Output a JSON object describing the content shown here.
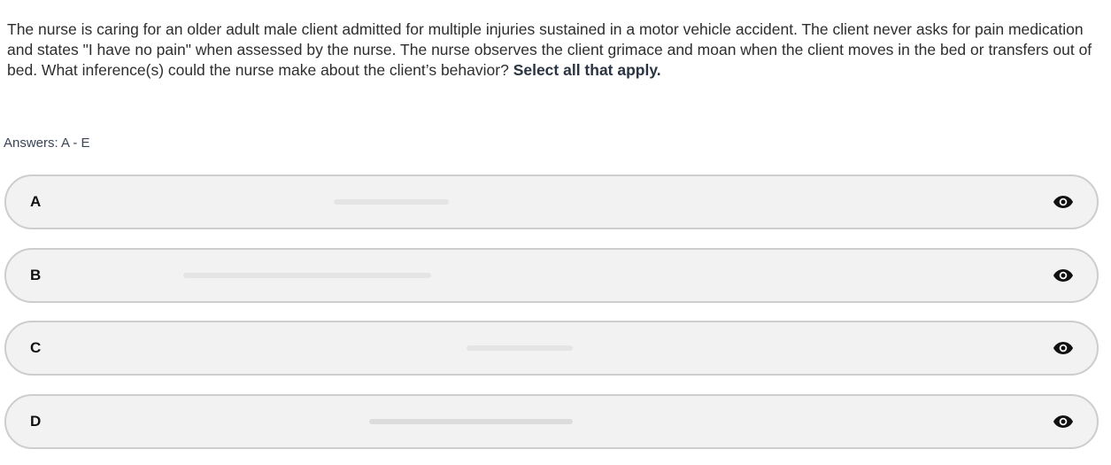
{
  "question": {
    "text": "The nurse is caring for an older adult male client admitted for multiple injuries sustained in a motor vehicle accident. The client never asks for pain medication and states \"I have no pain\" when assessed by the nurse. The nurse observes the client grimace and moan when the client moves in the bed or transfers out of bed. What inference(s) could the nurse make about the client’s behavior?",
    "emphasis": "Select all that apply."
  },
  "answers_label": "Answers: A - E",
  "options": [
    {
      "letter": "A",
      "icon": "eye-icon"
    },
    {
      "letter": "B",
      "icon": "eye-icon"
    },
    {
      "letter": "C",
      "icon": "eye-icon"
    },
    {
      "letter": "D",
      "icon": "eye-icon"
    }
  ],
  "colors": {
    "option_background": "#f2f2f2",
    "option_border": "#cdcdcd",
    "question_text": "#2e2e2e",
    "label_text": "#3a4556"
  }
}
